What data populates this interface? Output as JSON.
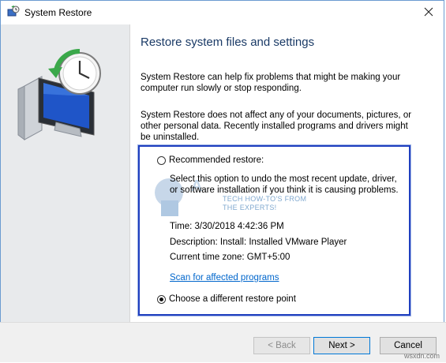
{
  "window": {
    "title": "System Restore"
  },
  "main": {
    "heading": "Restore system files and settings",
    "paragraph1": "System Restore can help fix problems that might be making your computer run slowly or stop responding.",
    "paragraph2": "System Restore does not affect any of your documents, pictures, or other personal data. Recently installed programs and drivers might be uninstalled."
  },
  "options": {
    "recommended": {
      "label": "Recommended restore:",
      "description": "Select this option to undo the most recent update, driver, or software installation if you think it is causing problems.",
      "time": "Time: 3/30/2018 4:42:36 PM",
      "descriptionLine": "Description: Install: Installed VMware Player",
      "timezone": "Current time zone: GMT+5:00",
      "scan_link": "Scan for affected programs",
      "selected": false
    },
    "different": {
      "label": "Choose a different restore point",
      "selected": true
    }
  },
  "watermark": {
    "line1": "TECH HOW-TO'S FROM",
    "line2": "THE EXPERTS!"
  },
  "footer": {
    "back": "< Back",
    "next": "Next >",
    "cancel": "Cancel"
  },
  "source_tag": "wsxdn.com",
  "colors": {
    "highlight_box": "#1f3fbf",
    "link": "#0066cc",
    "heading": "#1a3a66"
  }
}
